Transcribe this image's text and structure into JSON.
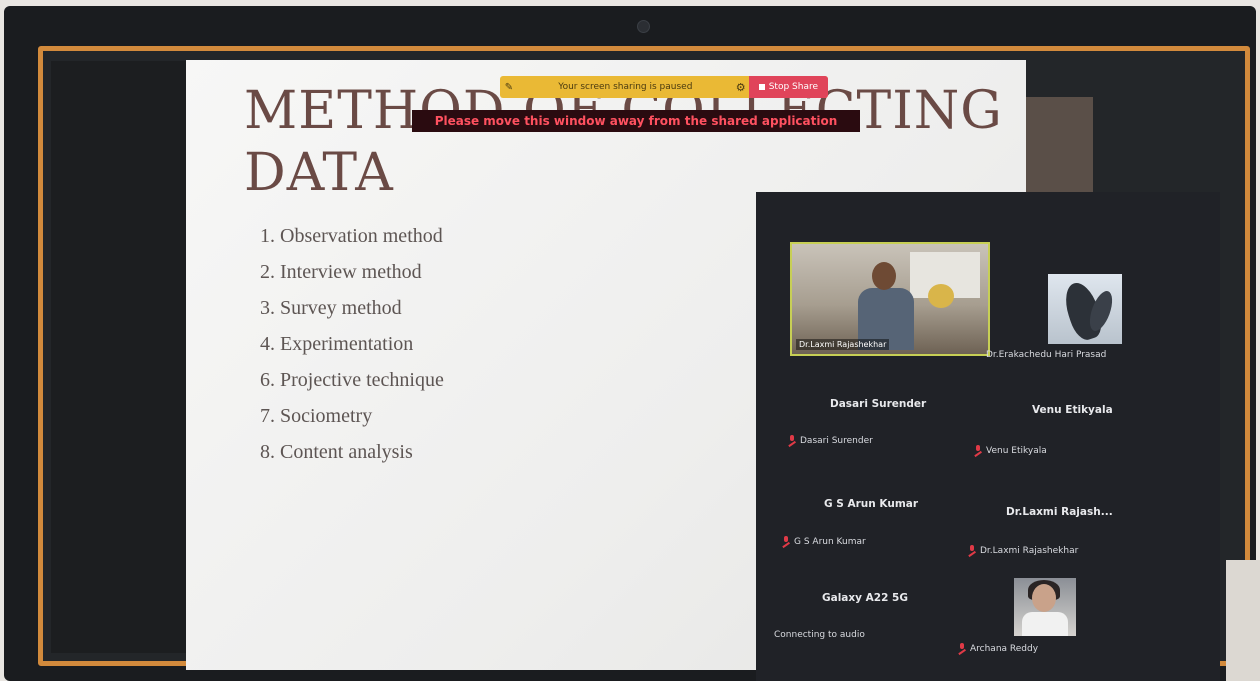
{
  "slide": {
    "title_line1": "METHOD OF COLLECTING",
    "title_line2": "DATA",
    "items": [
      "1. Observation method",
      "2. Interview method",
      "3. Survey method",
      "4. Experimentation",
      "6. Projective technique",
      "7. Sociometry",
      "8. Content analysis"
    ]
  },
  "share_toolbar": {
    "status": "Your screen sharing is paused",
    "stop_label": "Stop Share",
    "warning": "Please move this window away from the shared application"
  },
  "participants": {
    "main_video_label": "Dr.Laxmi Rajashekhar",
    "p2_label": "Dr.Erakachedu Hari Prasad",
    "p3_center": "Dasari Surender",
    "p3_label": "Dasari Surender",
    "p4_center": "Venu Etikyala",
    "p4_label": "Venu Etikyala",
    "p5_center": "G S Arun Kumar",
    "p5_label": "G S Arun Kumar",
    "p6_center": "Dr.Laxmi  Rajash...",
    "p6_label": "Dr.Laxmi Rajashekhar",
    "p7_center": "Galaxy A22 5G",
    "p7_label": "Connecting to audio",
    "p8_label": "Archana Reddy"
  },
  "colors": {
    "frame": "#d28a3c",
    "share_bar": "#eab935",
    "stop_share": "#e0445a",
    "warning_text": "#ff5160",
    "mic_muted": "#e03a47"
  }
}
